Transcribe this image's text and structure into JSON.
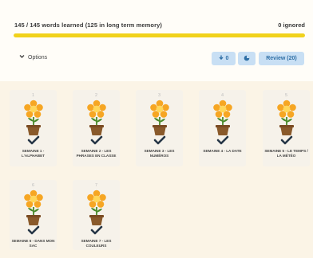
{
  "header": {
    "progress_text": "145 / 145 words learned (125 in long term memory)",
    "ignored_text": "0 ignored",
    "progress_fraction": 1.0
  },
  "toolbar": {
    "options_label": "Options",
    "download_count": "0",
    "review_label": "Review (20)"
  },
  "colors": {
    "progress": "#f1d21b",
    "button_bg": "#c8dff4",
    "button_text": "#2f6fa5",
    "flower": "#f6a623",
    "pot": "#8a5a2b"
  },
  "icons": {
    "options": "chevron-down-icon",
    "download": "download-icon",
    "stats": "stats-icon",
    "plant": "flower-pot-icon",
    "learned": "check-icon"
  },
  "lessons": [
    {
      "number": "1",
      "title": "SEMAINE 1 - L'ALPHABET"
    },
    {
      "number": "2",
      "title": "SEMAINE 2 - LES PHRASES EN CLASSE"
    },
    {
      "number": "3",
      "title": "SEMAINE 3 - LES NUMÉROS"
    },
    {
      "number": "4",
      "title": "SEMAINE 4 - LA DATE"
    },
    {
      "number": "5",
      "title": "SEMAINE 5 - LE TEMPS / LA MÉTÉO"
    },
    {
      "number": "6",
      "title": "SEMAINE 6 - DANS MON SAC"
    },
    {
      "number": "7",
      "title": "SEMAINE 7 - LES COULEURS"
    }
  ]
}
